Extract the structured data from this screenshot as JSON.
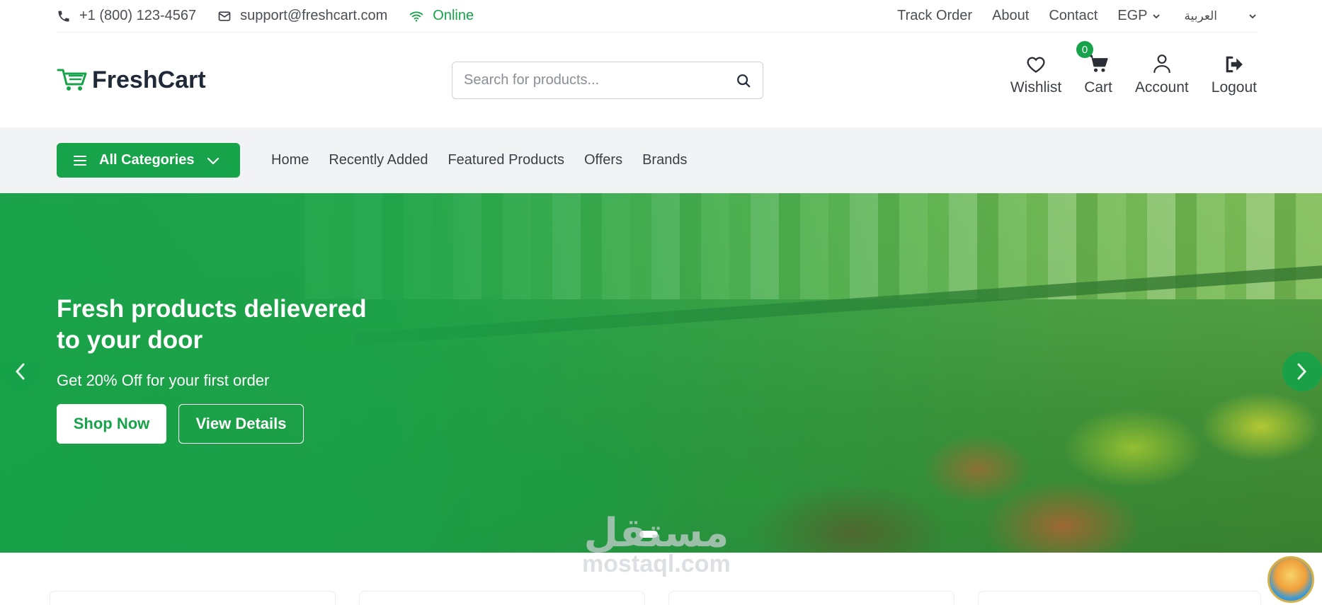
{
  "topbar": {
    "phone": "+1 (800) 123-4567",
    "email": "support@freshcart.com",
    "status": "Online",
    "links": [
      "Track Order",
      "About",
      "Contact"
    ],
    "currency": "EGP",
    "language": "العربية"
  },
  "header": {
    "brand": "FreshCart",
    "search_placeholder": "Search for products...",
    "actions": {
      "wishlist": "Wishlist",
      "cart": "Cart",
      "cart_count": "0",
      "account": "Account",
      "logout": "Logout"
    }
  },
  "nav": {
    "categories_label": "All Categories",
    "items": [
      "Home",
      "Recently Added",
      "Featured Products",
      "Offers",
      "Brands"
    ]
  },
  "hero": {
    "title": "Fresh products delievered to your door",
    "subtitle": "Get 20% Off for your first order",
    "primary_button": "Shop Now",
    "secondary_button": "View Details"
  },
  "watermark": {
    "arabic": "مستقل",
    "latin": "mostaql.com"
  },
  "colors": {
    "brand": "#16a34a",
    "nav_bg": "#f2f3f5"
  }
}
